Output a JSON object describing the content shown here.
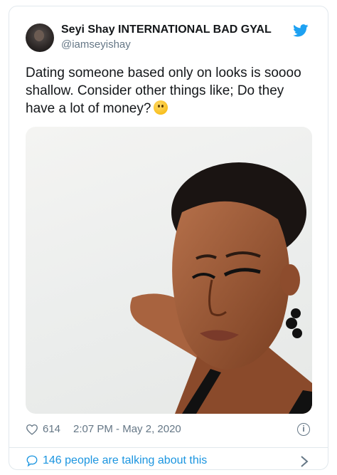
{
  "tweet": {
    "display_name": "Seyi Shay INTERNATIONAL BAD GYAL",
    "handle": "@iamseyishay",
    "text": "Dating someone based only on looks is soooo shallow. Consider other things like; Do they have a lot of money?",
    "emoji": "thinking-face",
    "likes": "614",
    "timestamp": "2:07 PM - May 2, 2020",
    "talking": "146 people are talking about this"
  },
  "colors": {
    "twitter_blue": "#1da1f2",
    "link_blue": "#1b95e0",
    "muted_gray": "#657786",
    "border": "#e1e8ed"
  },
  "icons": [
    "twitter-bird-icon",
    "heart-icon",
    "info-icon",
    "speech-bubble-icon",
    "chevron-right-icon"
  ]
}
